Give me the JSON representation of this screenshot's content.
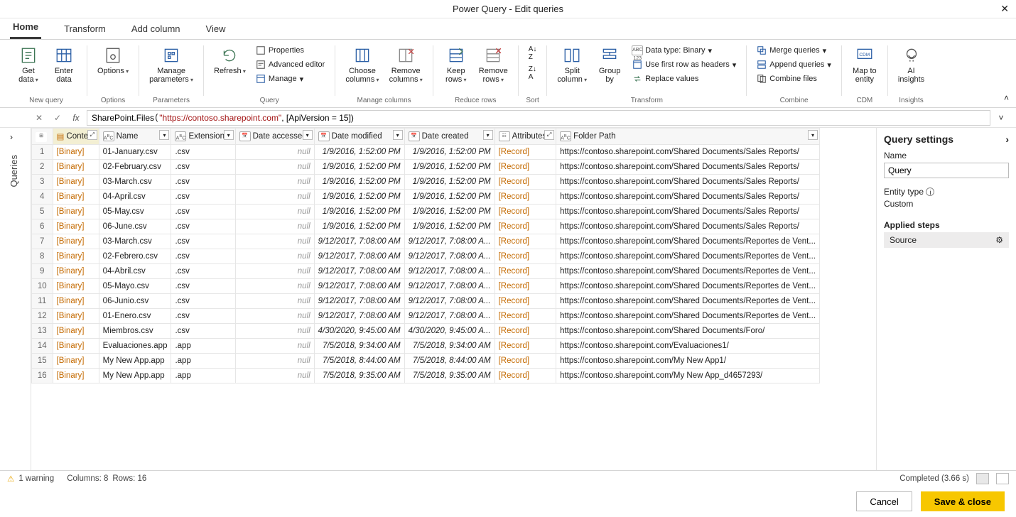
{
  "window": {
    "title": "Power Query - Edit queries"
  },
  "tabs": {
    "home": "Home",
    "transform": "Transform",
    "add": "Add column",
    "view": "View"
  },
  "ribbon": {
    "newquery": {
      "label": "New query",
      "getdata": "Get\ndata",
      "enterdata": "Enter\ndata"
    },
    "options": {
      "label": "Options",
      "options": "Options"
    },
    "parameters": {
      "label": "Parameters",
      "manage": "Manage\nparameters"
    },
    "query": {
      "label": "Query",
      "refresh": "Refresh",
      "properties": "Properties",
      "advanced": "Advanced editor",
      "manage": "Manage"
    },
    "managecols": {
      "label": "Manage columns",
      "choose": "Choose\ncolumns",
      "remove": "Remove\ncolumns"
    },
    "reducerows": {
      "label": "Reduce rows",
      "keep": "Keep\nrows",
      "remove": "Remove\nrows"
    },
    "sort": {
      "label": "Sort"
    },
    "transform": {
      "label": "Transform",
      "split": "Split\ncolumn",
      "group": "Group\nby",
      "datatype": "Data type: Binary",
      "firstrow": "Use first row as headers",
      "replace": "Replace values"
    },
    "combine": {
      "label": "Combine",
      "merge": "Merge queries",
      "append": "Append queries",
      "combinefiles": "Combine files"
    },
    "cdm": {
      "label": "CDM",
      "map": "Map to\nentity"
    },
    "insights": {
      "label": "Insights",
      "ai": "AI\ninsights"
    }
  },
  "formula": {
    "fn": "SharePoint.Files",
    "url": "\"https://contoso.sharepoint.com\"",
    "tail": ", [ApiVersion = 15])"
  },
  "sidebar": {
    "label": "Queries"
  },
  "columns": {
    "content": "Content",
    "name": "Name",
    "extension": "Extension",
    "accessed": "Date accessed",
    "modified": "Date modified",
    "created": "Date created",
    "attributes": "Attributes",
    "folder": "Folder Path"
  },
  "rows": [
    {
      "n": 1,
      "content": "[Binary]",
      "name": "01-January.csv",
      "ext": ".csv",
      "acc": "null",
      "mod": "1/9/2016, 1:52:00 PM",
      "cre": "1/9/2016, 1:52:00 PM",
      "attr": "[Record]",
      "folder": "https://contoso.sharepoint.com/Shared Documents/Sales Reports/"
    },
    {
      "n": 2,
      "content": "[Binary]",
      "name": "02-February.csv",
      "ext": ".csv",
      "acc": "null",
      "mod": "1/9/2016, 1:52:00 PM",
      "cre": "1/9/2016, 1:52:00 PM",
      "attr": "[Record]",
      "folder": "https://contoso.sharepoint.com/Shared Documents/Sales Reports/"
    },
    {
      "n": 3,
      "content": "[Binary]",
      "name": "03-March.csv",
      "ext": ".csv",
      "acc": "null",
      "mod": "1/9/2016, 1:52:00 PM",
      "cre": "1/9/2016, 1:52:00 PM",
      "attr": "[Record]",
      "folder": "https://contoso.sharepoint.com/Shared Documents/Sales Reports/"
    },
    {
      "n": 4,
      "content": "[Binary]",
      "name": "04-April.csv",
      "ext": ".csv",
      "acc": "null",
      "mod": "1/9/2016, 1:52:00 PM",
      "cre": "1/9/2016, 1:52:00 PM",
      "attr": "[Record]",
      "folder": "https://contoso.sharepoint.com/Shared Documents/Sales Reports/"
    },
    {
      "n": 5,
      "content": "[Binary]",
      "name": "05-May.csv",
      "ext": ".csv",
      "acc": "null",
      "mod": "1/9/2016, 1:52:00 PM",
      "cre": "1/9/2016, 1:52:00 PM",
      "attr": "[Record]",
      "folder": "https://contoso.sharepoint.com/Shared Documents/Sales Reports/"
    },
    {
      "n": 6,
      "content": "[Binary]",
      "name": "06-June.csv",
      "ext": ".csv",
      "acc": "null",
      "mod": "1/9/2016, 1:52:00 PM",
      "cre": "1/9/2016, 1:52:00 PM",
      "attr": "[Record]",
      "folder": "https://contoso.sharepoint.com/Shared Documents/Sales Reports/"
    },
    {
      "n": 7,
      "content": "[Binary]",
      "name": "03-March.csv",
      "ext": ".csv",
      "acc": "null",
      "mod": "9/12/2017, 7:08:00 AM",
      "cre": "9/12/2017, 7:08:00 A...",
      "attr": "[Record]",
      "folder": "https://contoso.sharepoint.com/Shared Documents/Reportes de Vent..."
    },
    {
      "n": 8,
      "content": "[Binary]",
      "name": "02-Febrero.csv",
      "ext": ".csv",
      "acc": "null",
      "mod": "9/12/2017, 7:08:00 AM",
      "cre": "9/12/2017, 7:08:00 A...",
      "attr": "[Record]",
      "folder": "https://contoso.sharepoint.com/Shared Documents/Reportes de Vent..."
    },
    {
      "n": 9,
      "content": "[Binary]",
      "name": "04-Abril.csv",
      "ext": ".csv",
      "acc": "null",
      "mod": "9/12/2017, 7:08:00 AM",
      "cre": "9/12/2017, 7:08:00 A...",
      "attr": "[Record]",
      "folder": "https://contoso.sharepoint.com/Shared Documents/Reportes de Vent..."
    },
    {
      "n": 10,
      "content": "[Binary]",
      "name": "05-Mayo.csv",
      "ext": ".csv",
      "acc": "null",
      "mod": "9/12/2017, 7:08:00 AM",
      "cre": "9/12/2017, 7:08:00 A...",
      "attr": "[Record]",
      "folder": "https://contoso.sharepoint.com/Shared Documents/Reportes de Vent..."
    },
    {
      "n": 11,
      "content": "[Binary]",
      "name": "06-Junio.csv",
      "ext": ".csv",
      "acc": "null",
      "mod": "9/12/2017, 7:08:00 AM",
      "cre": "9/12/2017, 7:08:00 A...",
      "attr": "[Record]",
      "folder": "https://contoso.sharepoint.com/Shared Documents/Reportes de Vent..."
    },
    {
      "n": 12,
      "content": "[Binary]",
      "name": "01-Enero.csv",
      "ext": ".csv",
      "acc": "null",
      "mod": "9/12/2017, 7:08:00 AM",
      "cre": "9/12/2017, 7:08:00 A...",
      "attr": "[Record]",
      "folder": "https://contoso.sharepoint.com/Shared Documents/Reportes de Vent..."
    },
    {
      "n": 13,
      "content": "[Binary]",
      "name": "Miembros.csv",
      "ext": ".csv",
      "acc": "null",
      "mod": "4/30/2020, 9:45:00 AM",
      "cre": "4/30/2020, 9:45:00 A...",
      "attr": "[Record]",
      "folder": "https://contoso.sharepoint.com/Shared Documents/Foro/"
    },
    {
      "n": 14,
      "content": "[Binary]",
      "name": "Evaluaciones.app",
      "ext": ".app",
      "acc": "null",
      "mod": "7/5/2018, 9:34:00 AM",
      "cre": "7/5/2018, 9:34:00 AM",
      "attr": "[Record]",
      "folder": "https://contoso.sharepoint.com/Evaluaciones1/"
    },
    {
      "n": 15,
      "content": "[Binary]",
      "name": "My New App.app",
      "ext": ".app",
      "acc": "null",
      "mod": "7/5/2018, 8:44:00 AM",
      "cre": "7/5/2018, 8:44:00 AM",
      "attr": "[Record]",
      "folder": "https://contoso.sharepoint.com/My New App1/"
    },
    {
      "n": 16,
      "content": "[Binary]",
      "name": "My New App.app",
      "ext": ".app",
      "acc": "null",
      "mod": "7/5/2018, 9:35:00 AM",
      "cre": "7/5/2018, 9:35:00 AM",
      "attr": "[Record]",
      "folder": "https://contoso.sharepoint.com/My New App_d4657293/"
    }
  ],
  "qs": {
    "title": "Query settings",
    "name_lbl": "Name",
    "name_val": "Query",
    "entity_lbl": "Entity type",
    "entity_val": "Custom",
    "steps_lbl": "Applied steps",
    "step1": "Source"
  },
  "status": {
    "warning": "1 warning",
    "cols": "Columns: 8",
    "rows": "Rows: 16",
    "completed": "Completed (3.66 s)"
  },
  "footer": {
    "cancel": "Cancel",
    "save": "Save & close"
  }
}
